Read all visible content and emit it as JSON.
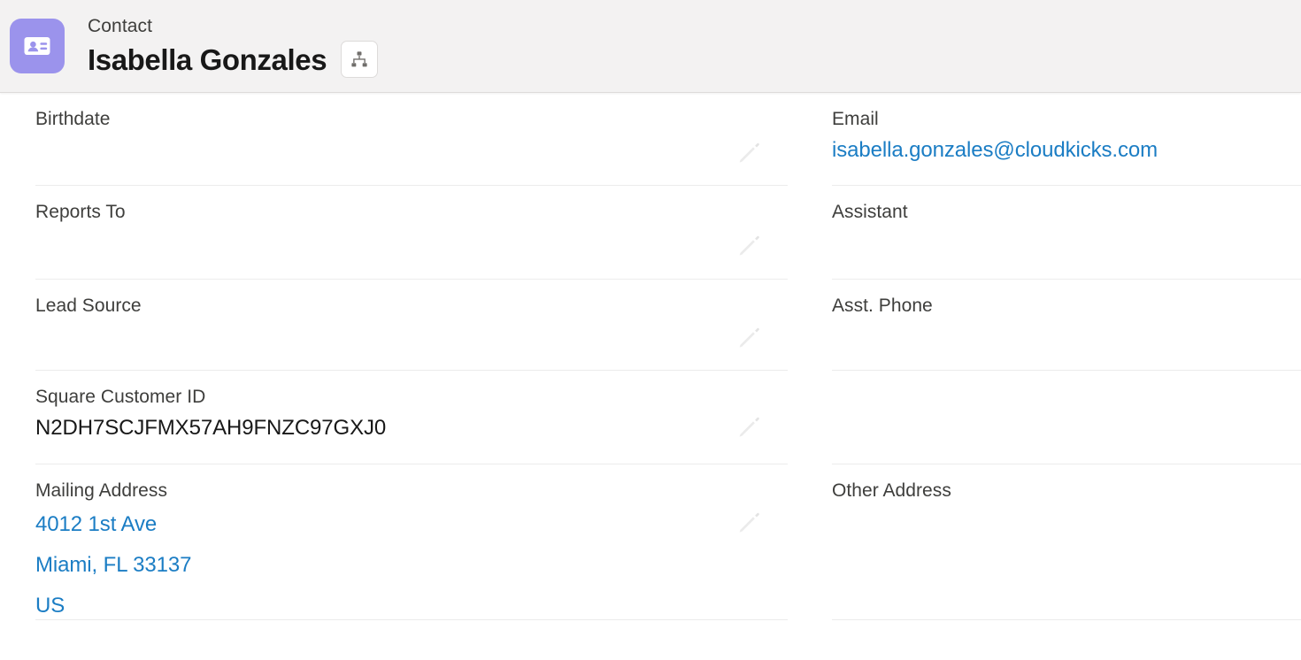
{
  "header": {
    "object_type": "Contact",
    "record_name": "Isabella Gonzales",
    "entity_icon": "contact-card-icon",
    "hierarchy_icon": "org-hierarchy-icon",
    "icon_bg_color": "#9b93ec"
  },
  "colors": {
    "link": "#1b7dc4",
    "label": "#3e3e3c",
    "value": "#181818",
    "header_bg": "#f3f2f2",
    "divider": "#ececec"
  },
  "left_column": [
    {
      "label": "Birthdate",
      "value": "",
      "editable": true,
      "type": "text"
    },
    {
      "label": "Reports To",
      "value": "",
      "editable": true,
      "type": "text"
    },
    {
      "label": "Lead Source",
      "value": "",
      "editable": true,
      "type": "text"
    },
    {
      "label": "Square Customer ID",
      "value": "N2DH7SCJFMX57AH9FNZC97GXJ0",
      "editable": true,
      "type": "text"
    },
    {
      "label": "Mailing Address",
      "value": "",
      "editable": true,
      "type": "address",
      "address_lines": [
        "4012 1st Ave",
        "Miami, FL 33137",
        "US"
      ]
    }
  ],
  "right_column": [
    {
      "label": "Email",
      "value": "isabella.gonzales@cloudkicks.com",
      "editable": false,
      "type": "link"
    },
    {
      "label": "Assistant",
      "value": "",
      "editable": false,
      "type": "text"
    },
    {
      "label": "Asst. Phone",
      "value": "",
      "editable": false,
      "type": "text"
    },
    {
      "label": "",
      "value": "",
      "editable": false,
      "type": "text"
    },
    {
      "label": "Other Address",
      "value": "",
      "editable": false,
      "type": "address",
      "address_lines": []
    }
  ]
}
